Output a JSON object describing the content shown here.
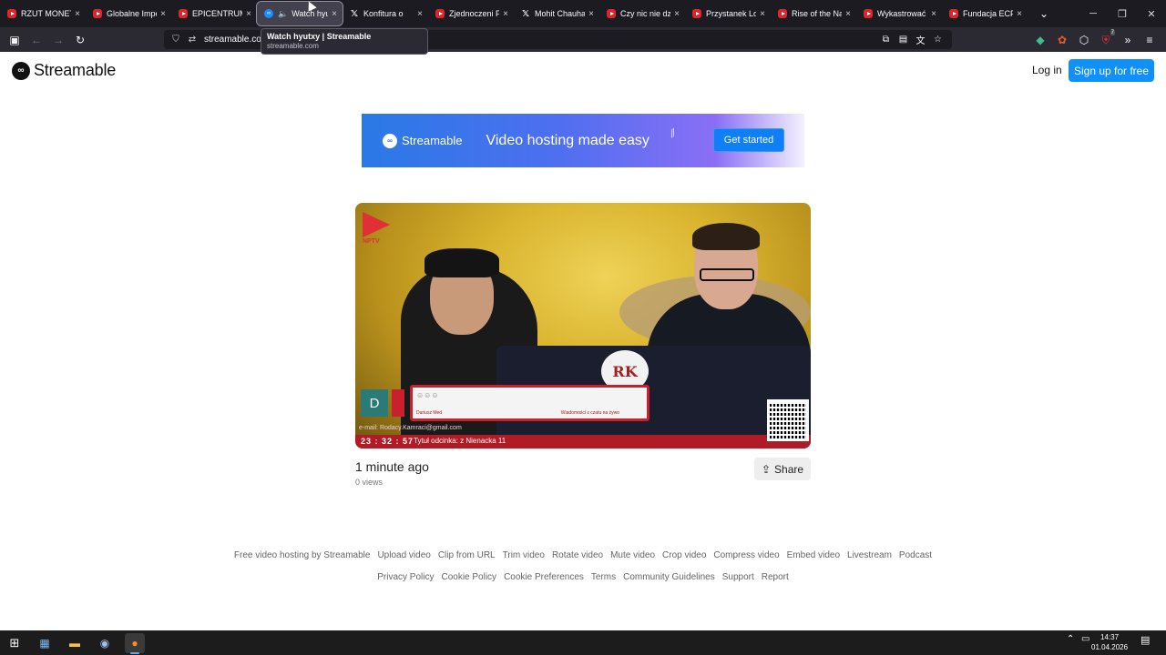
{
  "browser": {
    "tabs": [
      {
        "title": "RZUT MONETĄ",
        "favicon": "youtube-icon"
      },
      {
        "title": "Globalne Imperi",
        "favicon": "youtube-icon"
      },
      {
        "title": "EPICENTRUM PI",
        "favicon": "youtube-icon"
      },
      {
        "title": "Watch hyu",
        "favicon": "streamable-icon",
        "active": true
      },
      {
        "title": "Konfitura o",
        "favicon": "x-icon"
      },
      {
        "title": "Zjednoczeni Pra",
        "favicon": "youtube-icon"
      },
      {
        "title": "Mohit Chauhan",
        "favicon": "x-icon"
      },
      {
        "title": "Czy nic nie dzieje",
        "favicon": "youtube-icon"
      },
      {
        "title": "Przystanek Lom",
        "favicon": "youtube-icon"
      },
      {
        "title": "Rise of the Nazi",
        "favicon": "youtube-icon"
      },
      {
        "title": "Wykastrować b",
        "favicon": "youtube-icon"
      },
      {
        "title": "Fundacja ECPU",
        "favicon": "youtube-icon"
      }
    ],
    "tooltip": {
      "title": "Watch hyutxy | Streamable",
      "domain": "streamable.com"
    },
    "url": "streamable.com",
    "tab_close": "×",
    "notification_badge": "7"
  },
  "header": {
    "logo": "Streamable",
    "login": "Log in",
    "signup": "Sign up for free"
  },
  "banner": {
    "brand": "Streamable",
    "tagline": "Video hosting made easy",
    "cta": "Get started"
  },
  "video": {
    "channel_logo_text": "NPTV",
    "overlay_letter": "D",
    "overlay_name": "Dariusz Med",
    "overlay_message": "Wiadomości z czatu na żywo",
    "overlay_email": "e-mail: Rodacy.Kamraci@gmail.com",
    "overlay_clock": "23 : 32 : 57",
    "overlay_title": "Tytuł odcinka: z Nienacka 11",
    "crest": "RK"
  },
  "meta": {
    "time": "1 minute ago",
    "views": "0 views",
    "share": "Share"
  },
  "footer": {
    "row1": [
      "Free video hosting by Streamable",
      "Upload video",
      "Clip from URL",
      "Trim video",
      "Rotate video",
      "Mute video",
      "Crop video",
      "Compress video",
      "Embed video",
      "Livestream",
      "Podcast"
    ],
    "row2": [
      "Privacy Policy",
      "Cookie Policy",
      "Cookie Preferences",
      "Terms",
      "Community Guidelines",
      "Support",
      "Report"
    ]
  },
  "taskbar": {
    "time": "14:37",
    "date": "01.04.2026"
  },
  "colors": {
    "brand_blue": "#0f90fa",
    "tab_bg": "#1c1b22",
    "toolbar_bg": "#2b2a33"
  }
}
